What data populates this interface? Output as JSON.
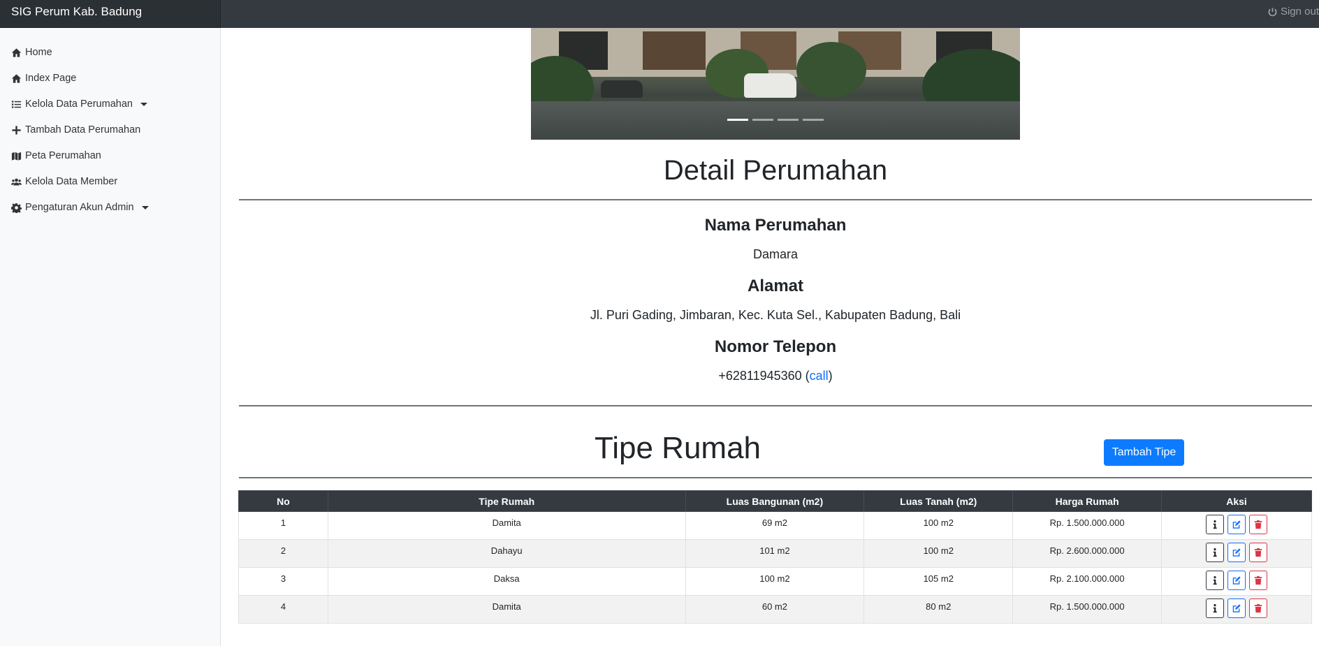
{
  "navbar": {
    "brand": "SIG Perum Kab. Badung",
    "signout": "Sign out"
  },
  "sidebar": {
    "items": [
      {
        "label": "Home",
        "icon": "home-icon"
      },
      {
        "label": "Index Page",
        "icon": "home-icon"
      },
      {
        "label": "Kelola Data Perumahan",
        "icon": "list-icon",
        "dropdown": true
      },
      {
        "label": "Tambah Data Perumahan",
        "icon": "plus-icon"
      },
      {
        "label": "Peta Perumahan",
        "icon": "map-icon"
      },
      {
        "label": "Kelola Data Member",
        "icon": "users-icon"
      },
      {
        "label": "Pengaturan Akun Admin",
        "icon": "gear-icon",
        "dropdown": true
      }
    ]
  },
  "carousel": {
    "slides": 4,
    "active_index": 0
  },
  "detail": {
    "title": "Detail Perumahan",
    "nama_label": "Nama Perumahan",
    "nama_value": "Damara",
    "alamat_label": "Alamat",
    "alamat_value": "Jl. Puri Gading, Jimbaran, Kec. Kuta Sel., Kabupaten Badung, Bali",
    "telepon_label": "Nomor Telepon",
    "telepon_value": "+62811945360",
    "call_link": "call"
  },
  "tipe": {
    "title": "Tipe Rumah",
    "add_button": "Tambah Tipe",
    "columns": [
      "No",
      "Tipe Rumah",
      "Luas Bangunan (m2)",
      "Luas Tanah (m2)",
      "Harga Rumah",
      "Aksi"
    ],
    "rows": [
      [
        "1",
        "Damita",
        "69 m2",
        "100 m2",
        "Rp. 1.500.000.000"
      ],
      [
        "2",
        "Dahayu",
        "101 m2",
        "100 m2",
        "Rp. 2.600.000.000"
      ],
      [
        "3",
        "Daksa",
        "100 m2",
        "105 m2",
        "Rp. 2.100.000.000"
      ],
      [
        "4",
        "Damita",
        "60 m2",
        "80 m2",
        "Rp. 1.500.000.000"
      ]
    ]
  },
  "colors": {
    "navbar": "#343a40",
    "primary": "#0d7bff",
    "danger": "#dc3545"
  }
}
